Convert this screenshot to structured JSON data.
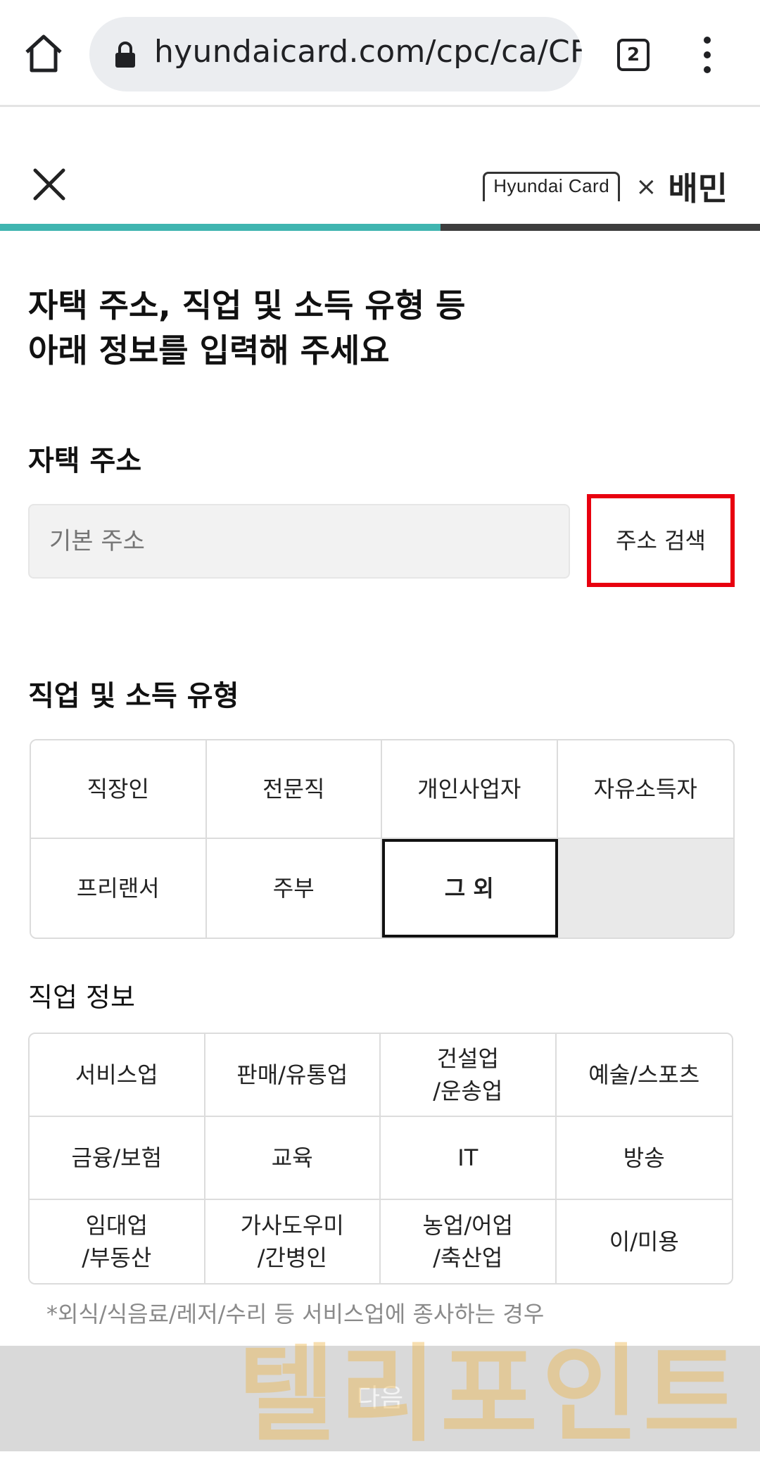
{
  "browser": {
    "url": "hyundaicard.com/cpc/ca/CF",
    "tab_count": "2"
  },
  "header": {
    "brand_hyundai": "Hyundai Card",
    "brand_x": "×",
    "brand_baemin": "배민"
  },
  "progress": {
    "fraction": 0.58,
    "fill_color": "#3fb5b0",
    "track_color": "#3d3d3d"
  },
  "heading": {
    "line1": "자택 주소, 직업 및 소득 유형 등",
    "line2": "아래 정보를 입력해 주세요"
  },
  "address": {
    "label": "자택 주소",
    "placeholder": "기본 주소",
    "search_button": "주소 검색",
    "highlight_color": "#e8000f"
  },
  "job": {
    "label": "직업 및 소득 유형",
    "options": [
      "직장인",
      "전문직",
      "개인사업자",
      "자유소득자",
      "프리랜서",
      "주부",
      "그 외"
    ],
    "selected": "그 외"
  },
  "industry": {
    "label": "직업 정보",
    "options": [
      "서비스업",
      "판매/유통업",
      "건설업\n/운송업",
      "예술/스포츠",
      "금융/보험",
      "교육",
      "IT",
      "방송",
      "임대업\n/부동산",
      "가사도우미\n/간병인",
      "농업/어업\n/축산업",
      "이/미용"
    ],
    "note": "*외식/식음료/레저/수리 등 서비스업에 종사하는 경우"
  },
  "next_button": "다음",
  "watermark": "텔리포인트"
}
